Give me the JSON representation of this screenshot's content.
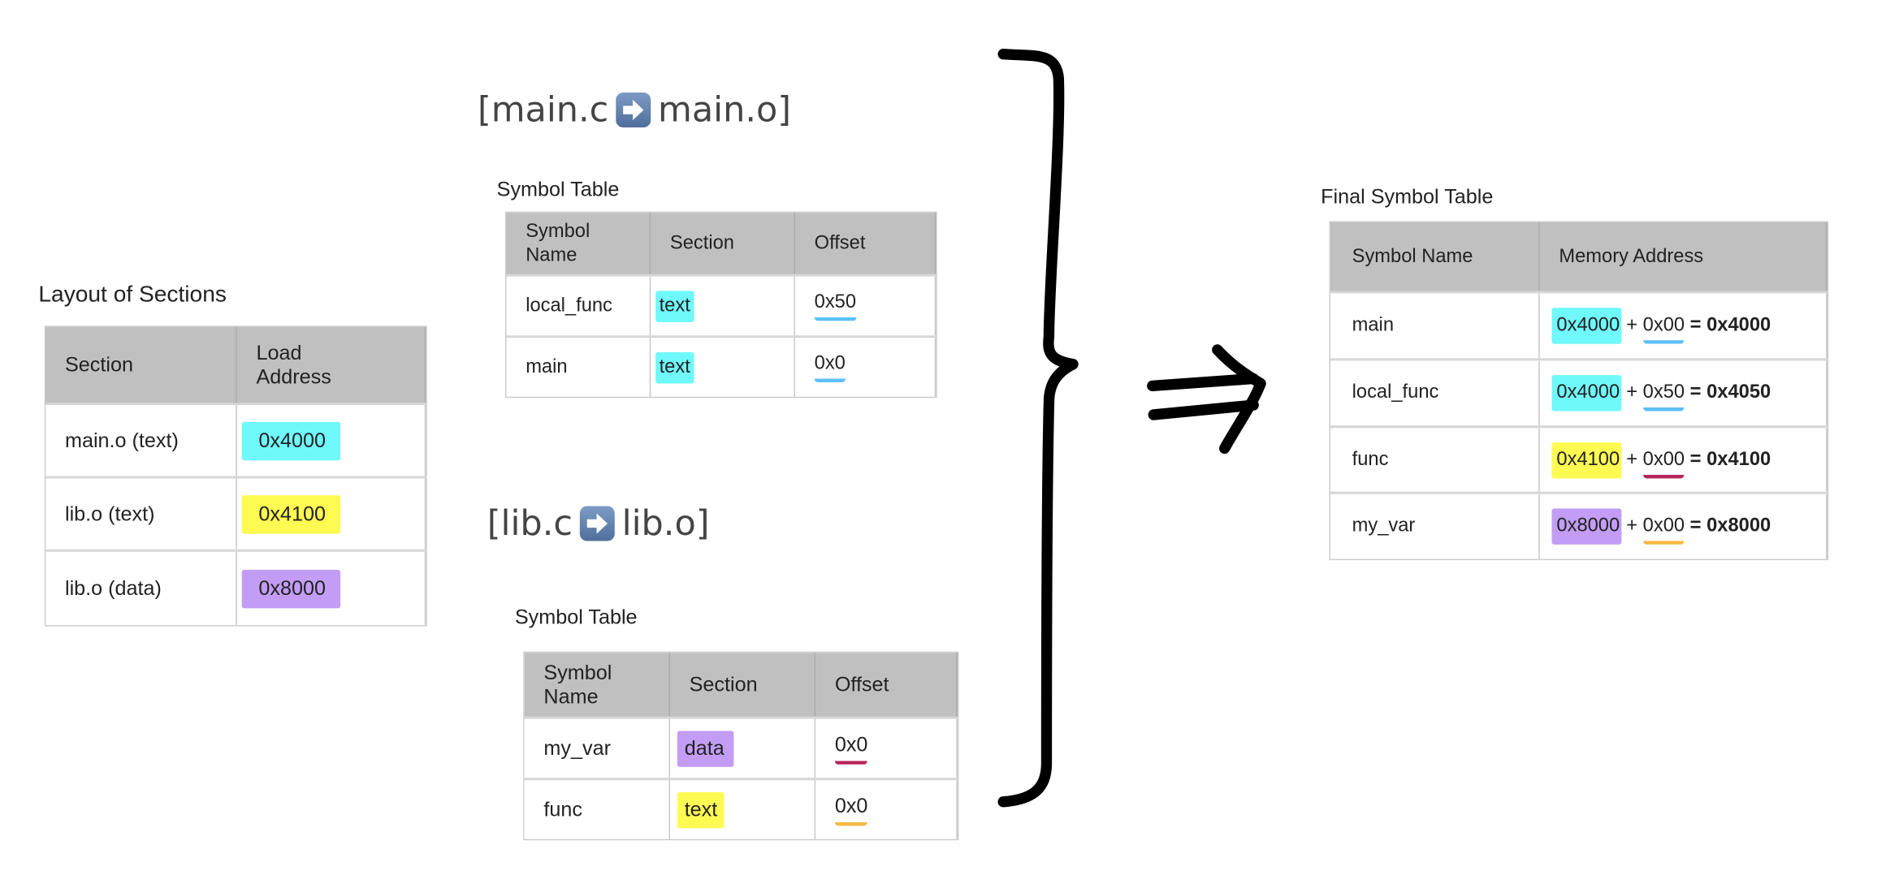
{
  "colors": {
    "text_highlight": "#6ff9fb",
    "lib_text_highlight": "#fdfb52",
    "data_highlight": "#c39df5",
    "underline_blue": "#5bc0f5",
    "underline_crimson": "#b8245c",
    "underline_orange": "#f5b942",
    "header_bg": "#c0c0c0"
  },
  "main_heading": {
    "left": "[main.c",
    "icon": "right-arrow-emoji",
    "right": "main.o]"
  },
  "lib_heading": {
    "left": "[lib.c",
    "icon": "right-arrow-emoji",
    "right": "lib.o]"
  },
  "layout": {
    "title": "Layout of Sections",
    "headers": [
      "Section",
      "Load Address"
    ],
    "rows": [
      {
        "section": "main.o (text)",
        "address": "0x4000"
      },
      {
        "section": "lib.o (text)",
        "address": "0x4100"
      },
      {
        "section": "lib.o (data)",
        "address": "0x8000"
      }
    ]
  },
  "main_symbols": {
    "title": "Symbol Table",
    "headers": [
      "Symbol Name",
      "Section",
      "Offset"
    ],
    "rows": [
      {
        "name": "local_func",
        "section": "text",
        "offset": "0x50"
      },
      {
        "name": "main",
        "section": "text",
        "offset": "0x0"
      }
    ]
  },
  "lib_symbols": {
    "title": "Symbol Table",
    "headers": [
      "Symbol Name",
      "Section",
      "Offset"
    ],
    "rows": [
      {
        "name": "my_var",
        "section": "data",
        "offset": "0x0"
      },
      {
        "name": "func",
        "section": "text",
        "offset": "0x0"
      }
    ]
  },
  "final": {
    "title": "Final Symbol Table",
    "headers": [
      "Symbol Name",
      "Memory Address"
    ],
    "rows": [
      {
        "name": "main",
        "base": "0x4000",
        "plus": "+",
        "offset": "0x00",
        "eq": "=",
        "result": "0x4000"
      },
      {
        "name": "local_func",
        "base": "0x4000",
        "plus": "+",
        "offset": "0x50",
        "eq": "=",
        "result": "0x4050"
      },
      {
        "name": "func",
        "base": "0x4100",
        "plus": "+",
        "offset": "0x00",
        "eq": "=",
        "result": "0x4100"
      },
      {
        "name": "my_var",
        "base": "0x8000",
        "plus": "+",
        "offset": "0x00",
        "eq": "=",
        "result": "0x8000"
      }
    ]
  }
}
